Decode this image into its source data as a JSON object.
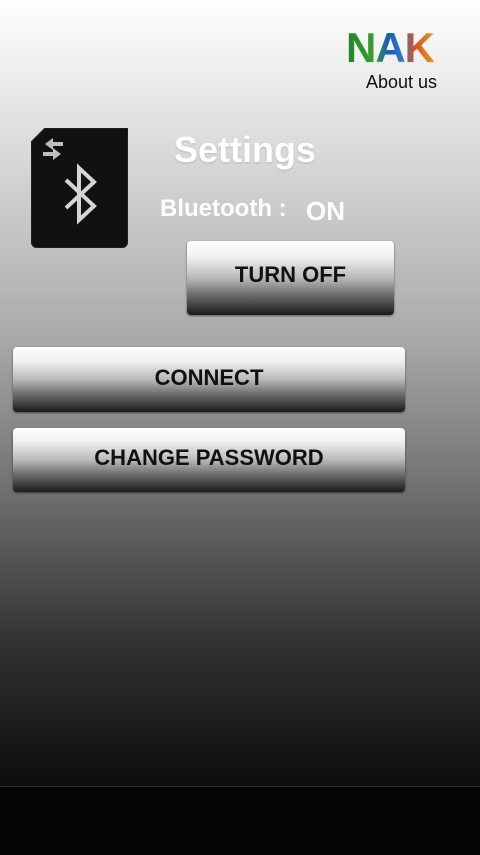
{
  "header": {
    "logo_text": "NAK",
    "about_label": "About us"
  },
  "settings": {
    "title": "Settings",
    "bluetooth_label": "Bluetooth :",
    "bluetooth_status": "ON"
  },
  "buttons": {
    "toggle_label": "TURN OFF",
    "connect_label": "CONNECT",
    "change_password_label": "CHANGE PASSWORD"
  },
  "colors": {
    "logo_green": "#3aa836",
    "logo_blue": "#1b5fc4",
    "logo_orange": "#f0a01a"
  },
  "icons": {
    "app_icon": "bluetooth-icon"
  }
}
